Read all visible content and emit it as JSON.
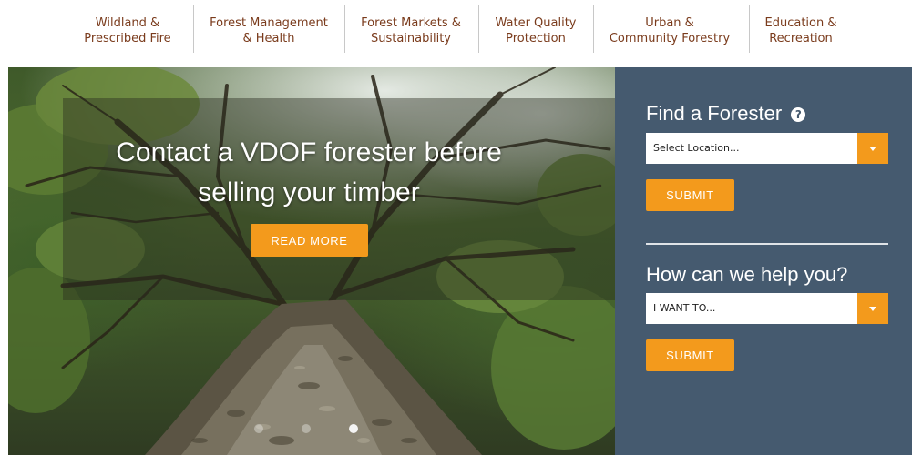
{
  "nav": {
    "items": [
      {
        "line1": "Wildland &",
        "line2": "Prescribed Fire"
      },
      {
        "line1": "Forest Management",
        "line2": "& Health"
      },
      {
        "line1": "Forest Markets &",
        "line2": "Sustainability"
      },
      {
        "line1": "Water Quality",
        "line2": "Protection"
      },
      {
        "line1": "Urban &",
        "line2": "Community Forestry"
      },
      {
        "line1": "Education &",
        "line2": "Recreation"
      }
    ]
  },
  "hero": {
    "title_line1": "Contact a VDOF forester before",
    "title_line2": "selling your timber",
    "read_more": "READ MORE",
    "slide_count": 3,
    "active_slide": 3
  },
  "find_forester": {
    "heading": "Find a Forester",
    "help_icon": "question-circle-icon",
    "select_value": "Select Location...",
    "submit": "SUBMIT"
  },
  "help": {
    "heading": "How can we help you?",
    "select_value": "I WANT TO...",
    "submit": "SUBMIT"
  },
  "colors": {
    "nav_text": "#7a3b1c",
    "accent": "#f39a1c",
    "panel": "#455a6f"
  }
}
